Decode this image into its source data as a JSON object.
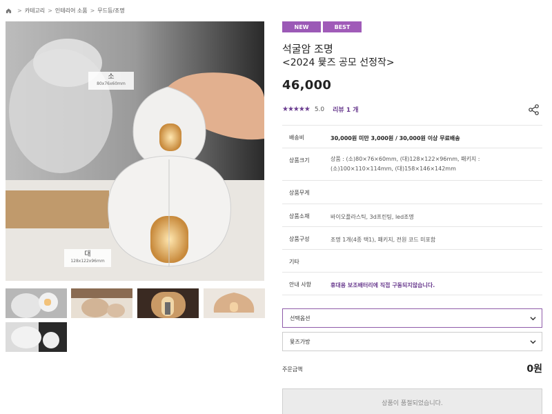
{
  "breadcrumb": {
    "items": [
      "카테고리",
      "인테리어 소품",
      "무드등/조명"
    ],
    "separator": ">"
  },
  "gallery": {
    "main_image": {
      "size_small": {
        "name": "소",
        "dims": "80x76x60mm"
      },
      "size_large": {
        "name": "대",
        "dims": "128x122x96mm"
      }
    },
    "thumbnail_count": 5
  },
  "product": {
    "badges": [
      {
        "label": "NEW",
        "color": "#9b59b6"
      },
      {
        "label": "BEST",
        "color": "#a05bb8"
      }
    ],
    "title": "석굴암 조명",
    "subtitle": "<2024 뮻즈 공모 선정작>",
    "price": "46,000",
    "rating": {
      "stars": "★★★★★",
      "score": "5.0",
      "review_label": "리뷰 1 개"
    },
    "info": [
      {
        "label": "배송비",
        "value": "30,000원 미만 3,000원 / 30,000원 이상 무료배송",
        "style": "bold"
      },
      {
        "label": "상품크기",
        "value": "상품 : (소)80×76×60mm, (대)128×122×96mm, 패키지 : (소)100×110×114mm, (대)158×146×142mm",
        "style": "normal"
      },
      {
        "label": "상품무게",
        "value": "",
        "style": "normal"
      },
      {
        "label": "상품소재",
        "value": "바이오플라스틱, 3d프린팅, led조명",
        "style": "normal"
      },
      {
        "label": "상품구성",
        "value": "조명 1개(4종 택1), 패키지, 전원 코드 미포함",
        "style": "normal"
      },
      {
        "label": "기타",
        "value": "",
        "style": "normal"
      },
      {
        "label": "안내 사항",
        "value": "휴대용 보조배터리에 직접 구동되지않습니다.",
        "style": "purple"
      }
    ],
    "option_select": "선택옵션",
    "bag_select": "뮻즈가방",
    "total_label": "주문금액",
    "total_value": "0원",
    "soldout_label": "상품이 품절되었습니다."
  },
  "colors": {
    "accent": "#6a3c8f",
    "badge": "#9b59b6"
  }
}
